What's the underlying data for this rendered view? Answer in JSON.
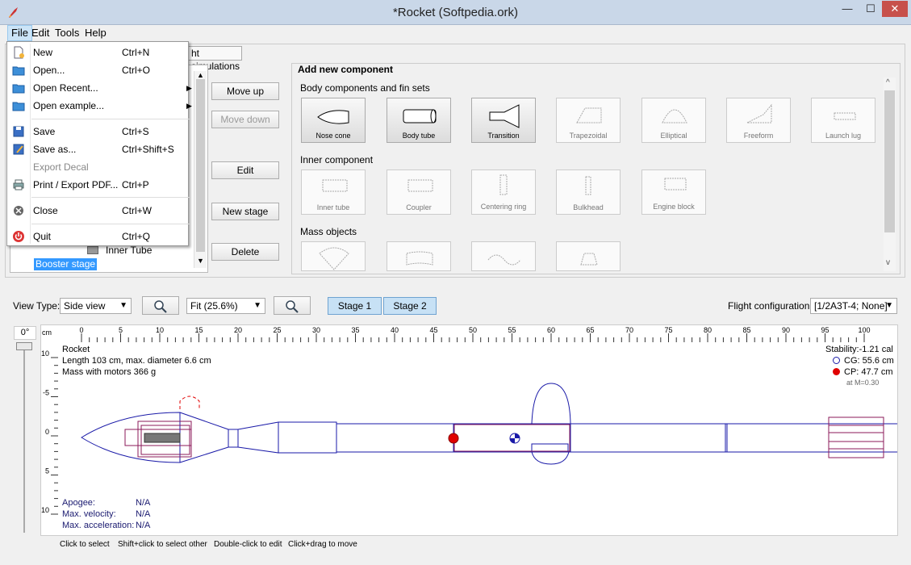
{
  "window": {
    "title": "*Rocket (Softpedia.ork)",
    "minimize_glyph": "—",
    "maximize_glyph": "☐",
    "close_glyph": "✕"
  },
  "menu": {
    "file": "File",
    "edit": "Edit",
    "tools": "Tools",
    "help": "Help"
  },
  "file_menu": [
    {
      "label": "New",
      "shortcut": "Ctrl+N",
      "icon": "new-file-icon"
    },
    {
      "label": "Open...",
      "shortcut": "Ctrl+O",
      "icon": "open-folder-icon"
    },
    {
      "label": "Open Recent...",
      "shortcut": "",
      "icon": "recent-folder-icon",
      "submenu": true
    },
    {
      "label": "Open example...",
      "shortcut": "",
      "icon": "example-folder-icon",
      "submenu": true
    },
    {
      "label": "Save",
      "shortcut": "Ctrl+S",
      "icon": "save-icon"
    },
    {
      "label": "Save as...",
      "shortcut": "Ctrl+Shift+S",
      "icon": "save-as-icon"
    },
    {
      "label": "Export Decal",
      "shortcut": "",
      "icon": "",
      "disabled": true
    },
    {
      "label": "Print / Export PDF...",
      "shortcut": "Ctrl+P",
      "icon": "print-icon"
    },
    {
      "label": "Close",
      "shortcut": "Ctrl+W",
      "icon": "close-circle-icon"
    },
    {
      "label": "Quit",
      "shortcut": "Ctrl+Q",
      "icon": "power-icon"
    }
  ],
  "submenu_arrow": "▶",
  "tabs": {
    "flight_simulations_partial": "ht simulations"
  },
  "tree": {
    "inner_tube": "Inner Tube",
    "booster_stage": "Booster stage"
  },
  "side_buttons": {
    "move_up": "Move up",
    "move_down": "Move down",
    "edit": "Edit",
    "new_stage": "New stage",
    "delete": "Delete"
  },
  "add_component": {
    "title": "Add new component",
    "body_section": "Body components and fin sets",
    "body": [
      "Nose cone",
      "Body tube",
      "Transition",
      "Trapezoidal",
      "Elliptical",
      "Freeform",
      "Launch lug"
    ],
    "inner_section": "Inner component",
    "inner": [
      "Inner tube",
      "Coupler",
      "Centering ring",
      "Bulkhead",
      "Engine block"
    ],
    "mass_section": "Mass objects"
  },
  "view": {
    "view_type_label": "View Type:",
    "view_type_value": "Side view",
    "zoom_value": "Fit (25.6%)",
    "stage1": "Stage 1",
    "stage2": "Stage 2",
    "flight_config_label": "Flight configuration:",
    "flight_config_value": "[1/2A3T-4; None]",
    "rotation": "0°",
    "ruler_unit": "cm"
  },
  "rocket_info": {
    "name": "Rocket",
    "length": "Length 103 cm, max. diameter 6.6 cm",
    "mass": "Mass with motors 366 g",
    "stability": "Stability:-1.21 cal",
    "cg": "CG: 55.6 cm",
    "cp": "CP: 47.7 cm",
    "mach": "at M=0.30",
    "apogee_label": "Apogee:",
    "apogee_value": "N/A",
    "velocity_label": "Max. velocity:",
    "velocity_value": "N/A",
    "accel_label": "Max. acceleration:",
    "accel_value": "N/A"
  },
  "hints": {
    "click": "Click to select",
    "shift": "Shift+click to select other",
    "double": "Double-click to edit",
    "drag": "Click+drag to move"
  },
  "ruler_top": [
    "0",
    "5",
    "10",
    "15",
    "20",
    "25",
    "30",
    "35",
    "40",
    "45",
    "50",
    "55",
    "60",
    "65",
    "70",
    "75",
    "80",
    "85",
    "90",
    "95",
    "100"
  ],
  "ruler_left": [
    "-10",
    "-5",
    "0",
    "5",
    "10"
  ],
  "colors": {
    "accent": "#c7e1f5",
    "outline": "#1a1aa8",
    "motor": "#8b1a5a",
    "cp": "#e00000"
  }
}
